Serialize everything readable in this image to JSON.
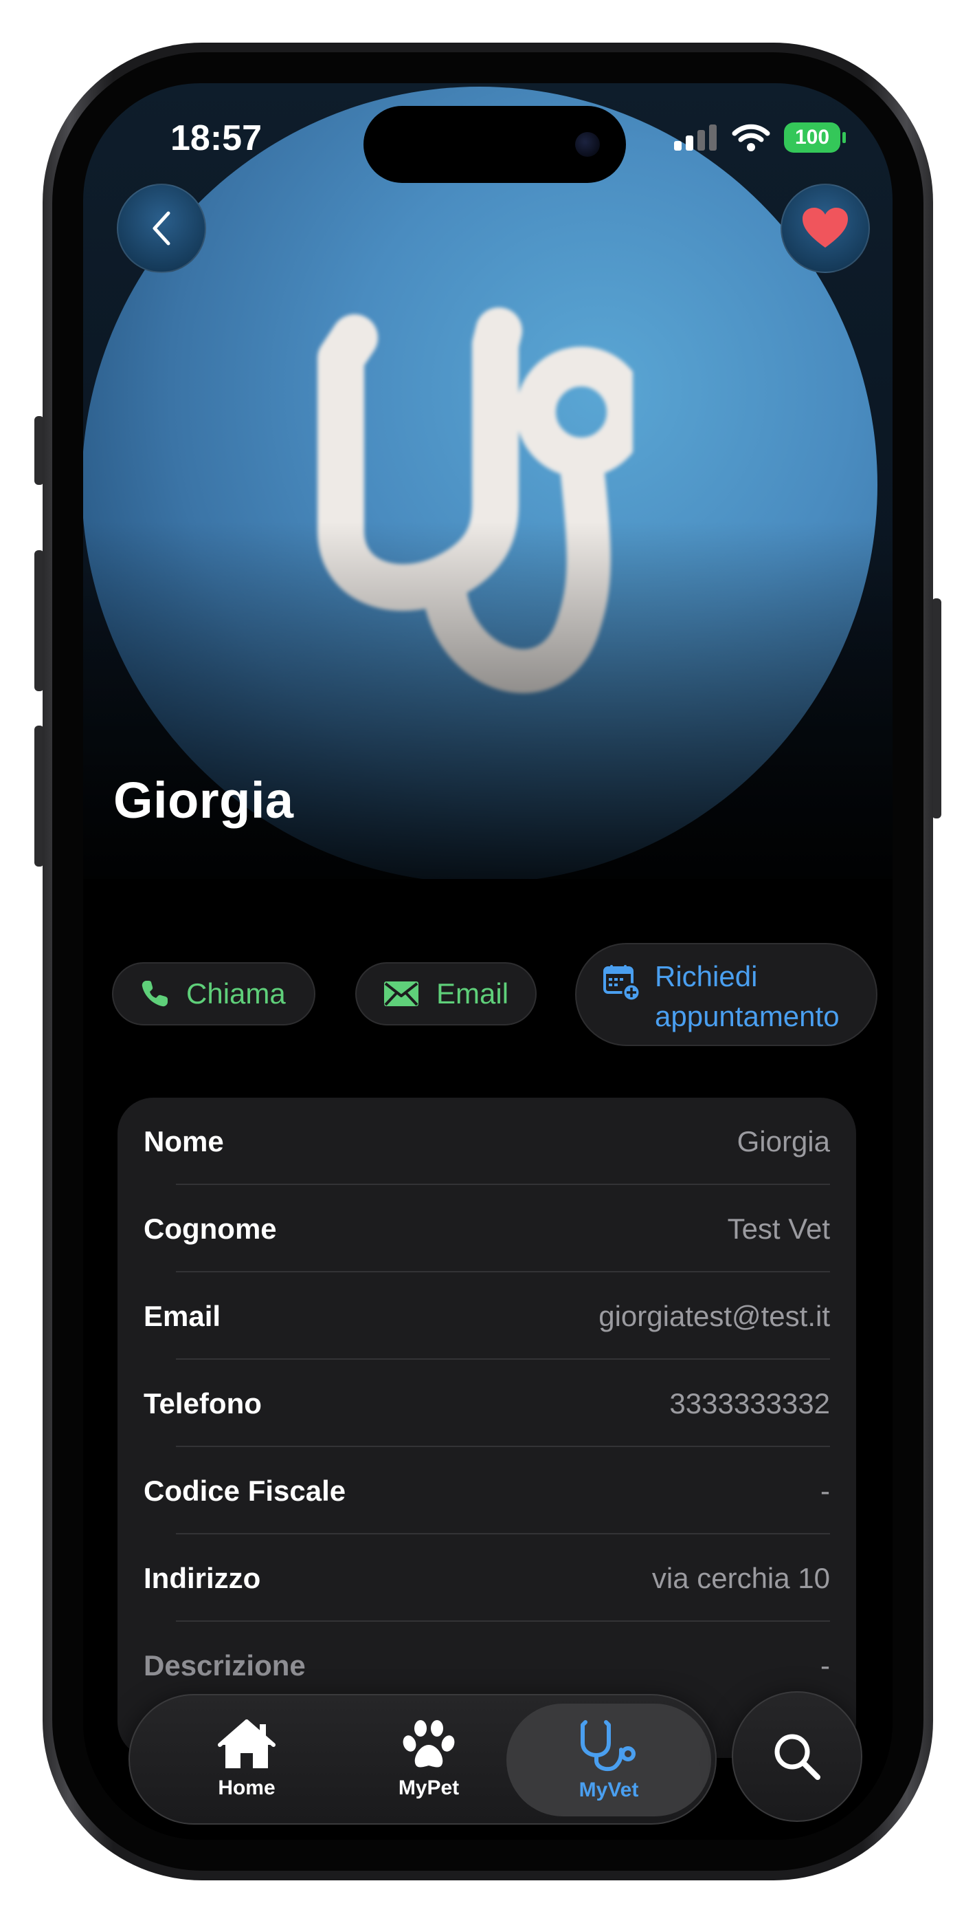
{
  "status_bar": {
    "time": "18:57",
    "battery": "100"
  },
  "hero": {
    "title": "Giorgia",
    "image_icon": "stethoscope-icon"
  },
  "nav": {
    "back_icon": "chevron-left-icon",
    "favorite_icon": "heart-icon",
    "favorite_color": "#f0555c"
  },
  "actions": {
    "call_label": "Chiama",
    "email_label": "Email",
    "appointment_label_line1": "Richiedi",
    "appointment_label_line2": "appuntamento",
    "call_icon": "phone-icon",
    "email_icon": "envelope-icon",
    "appointment_icon": "calendar-add-icon",
    "green_color": "#5fd07a",
    "blue_color": "#4a9ff0"
  },
  "details": [
    {
      "key": "Nome",
      "value": "Giorgia"
    },
    {
      "key": "Cognome",
      "value": "Test Vet"
    },
    {
      "key": "Email",
      "value": "giorgiatest@test.it"
    },
    {
      "key": "Telefono",
      "value": "3333333332"
    },
    {
      "key": "Codice Fiscale",
      "value": "-"
    },
    {
      "key": "Indirizzo",
      "value": "via cerchia 10"
    },
    {
      "key": "Descrizione",
      "value": "-"
    }
  ],
  "tabbar": {
    "items": [
      {
        "label": "Home",
        "icon": "house-icon",
        "active": false
      },
      {
        "label": "MyPet",
        "icon": "paw-icon",
        "active": false
      },
      {
        "label": "MyVet",
        "icon": "stethoscope-icon",
        "active": true
      }
    ],
    "search_icon": "search-icon"
  }
}
